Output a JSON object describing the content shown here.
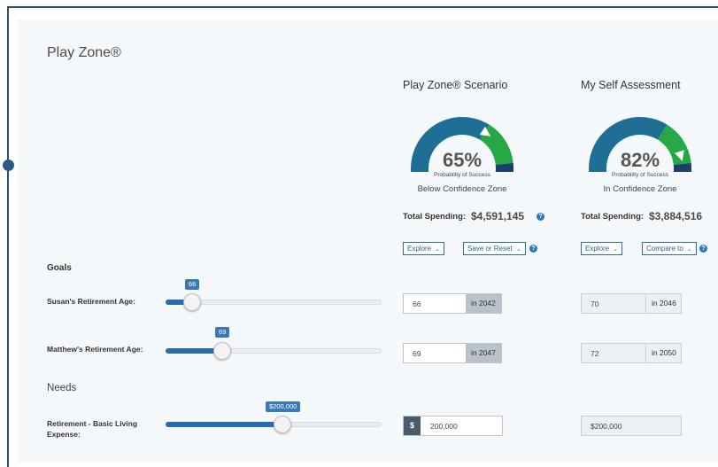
{
  "panel": {
    "title": "Play Zone®"
  },
  "columns": {
    "scenario": {
      "heading": "Play Zone® Scenario",
      "gauge": {
        "percent": "65%",
        "probability_label": "Probability of Success",
        "zone": "Below Confidence Zone",
        "value": 0.65
      },
      "spending_label": "Total Spending:",
      "spending_value": "$4,591,145",
      "explore_label": "Explore",
      "action_label": "Save or Reset"
    },
    "assessment": {
      "heading": "My Self Assessment",
      "gauge": {
        "percent": "82%",
        "probability_label": "Probability of Success",
        "zone": "In Confidence Zone",
        "value": 0.82
      },
      "spending_label": "Total Spending:",
      "spending_value": "$3,884,516",
      "explore_label": "Explore",
      "action_label": "Compare to"
    }
  },
  "goals": {
    "heading": "Goals",
    "rows": [
      {
        "label": "Susan's Retirement Age:",
        "slider_value": "66",
        "level": 0.08,
        "scenario_value": "66",
        "scenario_year": "in 2042",
        "assessment_value": "70",
        "assessment_year": "in 2046"
      },
      {
        "label": "Matthew's Retirement Age:",
        "slider_value": "69",
        "level": 0.22,
        "scenario_value": "69",
        "scenario_year": "in 2047",
        "assessment_value": "72",
        "assessment_year": "in 2050"
      }
    ]
  },
  "needs": {
    "heading": "Needs",
    "rows": [
      {
        "label": "Retirement - Basic Living Expense:",
        "slider_value": "$200,000",
        "level": 0.5,
        "currency": "$",
        "scenario_value": "200,000",
        "assessment_value": "$200,000"
      }
    ]
  },
  "colors": {
    "gauge_main": "#1e6e96",
    "gauge_green": "#27a845",
    "gauge_navy": "#1c3e6e",
    "accent": "#2a6bb0"
  }
}
